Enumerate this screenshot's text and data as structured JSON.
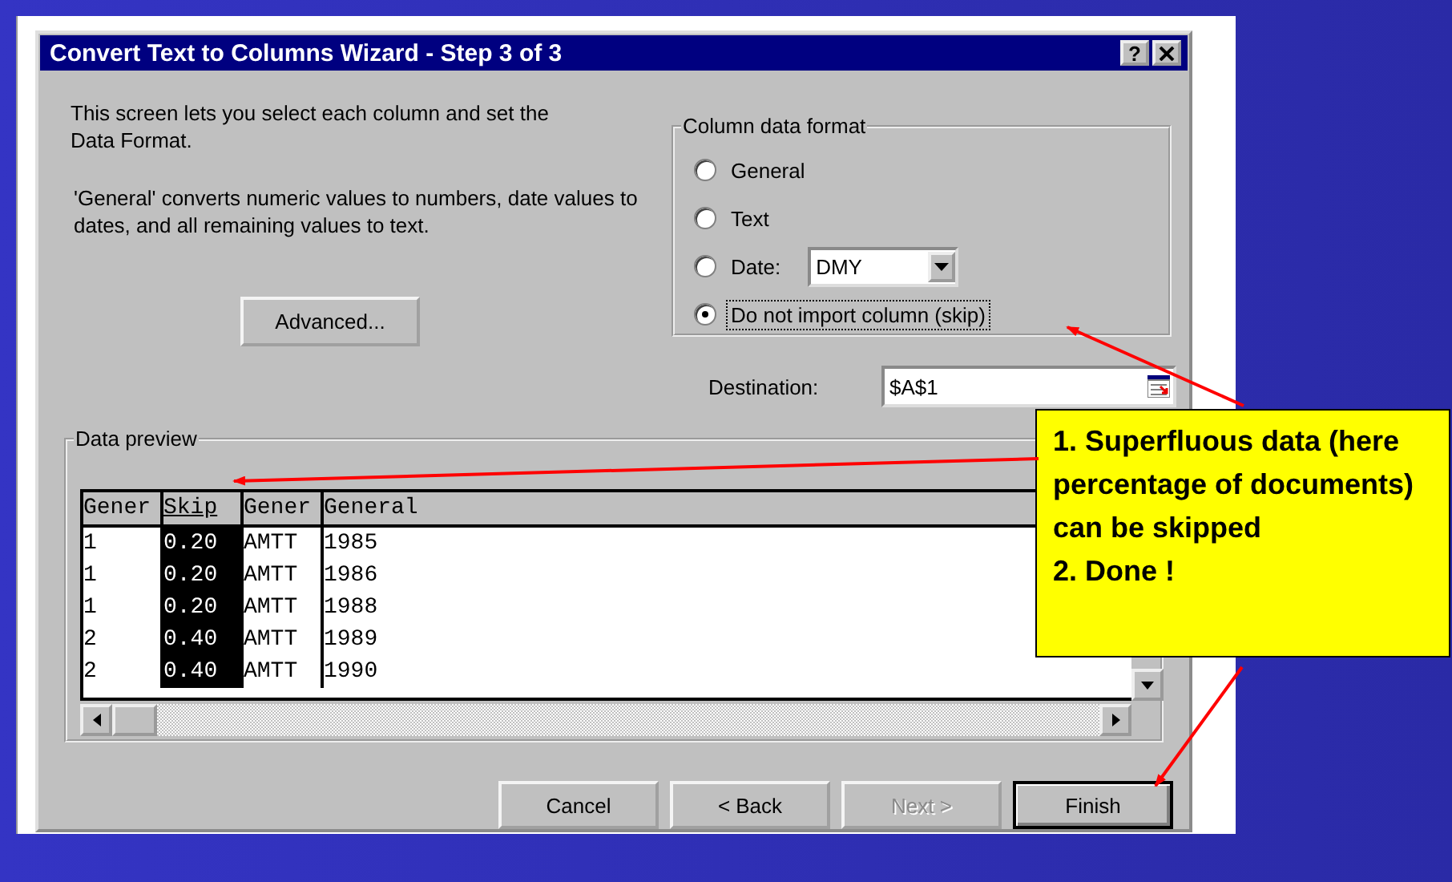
{
  "window": {
    "title": "Convert Text to Columns Wizard - Step 3 of 3",
    "help_button": "?"
  },
  "intro": "This screen lets you select each column and set the Data Format.",
  "explanation": "'General' converts numeric values to numbers, date values to dates, and all remaining values to text.",
  "advanced_button": "Advanced...",
  "format_group": {
    "title": "Column data format",
    "options": [
      {
        "label": "General",
        "selected": false
      },
      {
        "label": "Text",
        "selected": false
      },
      {
        "label": "Date:",
        "selected": false,
        "dropdown": "DMY"
      },
      {
        "label": "Do not import column (skip)",
        "selected": true
      }
    ]
  },
  "destination": {
    "label": "Destination:",
    "value": "$A$1"
  },
  "preview": {
    "title": "Data preview",
    "columns": [
      {
        "label": "Gener",
        "selected": false
      },
      {
        "label": "Skip",
        "selected": true
      },
      {
        "label": "Gener",
        "selected": false
      },
      {
        "label": "General",
        "selected": false
      }
    ],
    "rows": [
      [
        "1",
        "0.20",
        "AMTT",
        "1985"
      ],
      [
        "1",
        "0.20",
        "AMTT",
        "1986"
      ],
      [
        "1",
        "0.20",
        "AMTT",
        "1988"
      ],
      [
        "2",
        "0.40",
        "AMTT",
        "1989"
      ],
      [
        "2",
        "0.40",
        "AMTT",
        "1990"
      ]
    ]
  },
  "buttons": [
    {
      "label": "Cancel",
      "disabled": false,
      "default": false
    },
    {
      "label": "< Back",
      "disabled": false,
      "default": false
    },
    {
      "label": "Next >",
      "disabled": true,
      "default": false
    },
    {
      "label": "Finish",
      "disabled": false,
      "default": true
    }
  ],
  "callout": {
    "items": [
      "1. Superfluous data (here percentage of documents) can be skipped",
      "2. Done !"
    ]
  }
}
